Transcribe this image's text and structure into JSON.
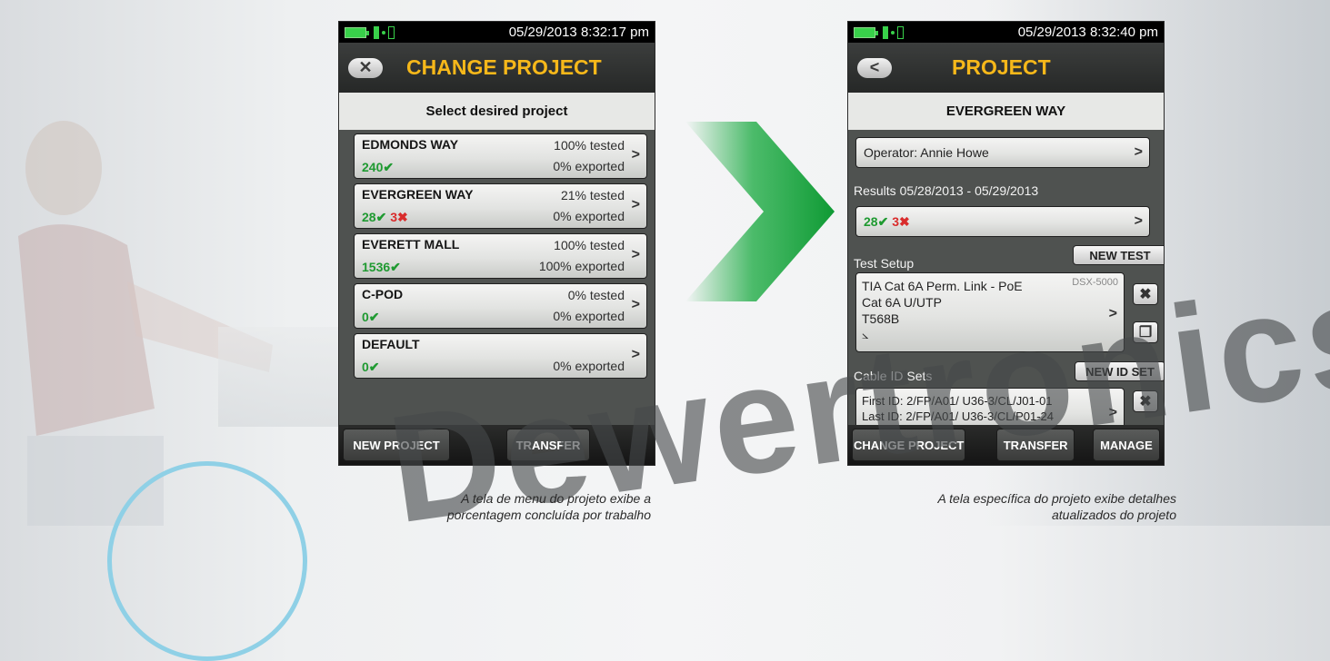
{
  "screen1": {
    "status_time": "05/29/2013 8:32:17 pm",
    "title": "CHANGE PROJECT",
    "subheading": "Select desired project",
    "projects": [
      {
        "name": "EDMONDS WAY",
        "tested": "100% tested",
        "exported": "0% exported",
        "pass": "240",
        "fail": ""
      },
      {
        "name": "EVERGREEN WAY",
        "tested": "21% tested",
        "exported": "0% exported",
        "pass": "28",
        "fail": "3"
      },
      {
        "name": "EVERETT MALL",
        "tested": "100% tested",
        "exported": "100% exported",
        "pass": "1536",
        "fail": ""
      },
      {
        "name": "C-POD",
        "tested": "0% tested",
        "exported": "0% exported",
        "pass": "0",
        "fail": ""
      },
      {
        "name": "DEFAULT",
        "tested": "",
        "exported": "0% exported",
        "pass": "0",
        "fail": ""
      }
    ],
    "buttons": {
      "new_project": "NEW PROJECT",
      "transfer": "TRANSFER"
    }
  },
  "screen2": {
    "status_time": "05/29/2013 8:32:40 pm",
    "title": "PROJECT",
    "subheading": "EVERGREEN WAY",
    "operator": "Operator: Annie Howe",
    "results_label": "Results 05/28/2013 - 05/29/2013",
    "results_pass": "28",
    "results_fail": "3",
    "test_setup_label": "Test Setup",
    "new_test": "NEW TEST",
    "setup_line1": "TIA Cat 6A Perm. Link - PoE",
    "setup_device": "DSX-5000",
    "setup_line2": "Cat 6A U/UTP",
    "setup_line3": "T568B",
    "cable_id_label": "Cable ID Sets",
    "new_id_set": "NEW ID SET",
    "first_id": "First ID: 2/FP/A01/ U36-3/CL/J01-01",
    "last_id": "Last ID: 2/FP/A01/ U36-3/CL/P01-24",
    "buttons": {
      "change_project": "CHANGE PROJECT",
      "transfer": "TRANSFER",
      "manage": "MANAGE"
    }
  },
  "captions": {
    "left": [
      "A tela de menu do projeto exibe a",
      "porcentagem concluída por trabalho"
    ],
    "right": [
      "A tela específica do projeto exibe detalhes",
      "atualizados do projeto"
    ]
  },
  "watermark": "Dewertronics",
  "colors": {
    "accent": "#f6b81a",
    "pass": "#1f9a31",
    "fail": "#d92c2c",
    "arrow": "#14a83c"
  }
}
